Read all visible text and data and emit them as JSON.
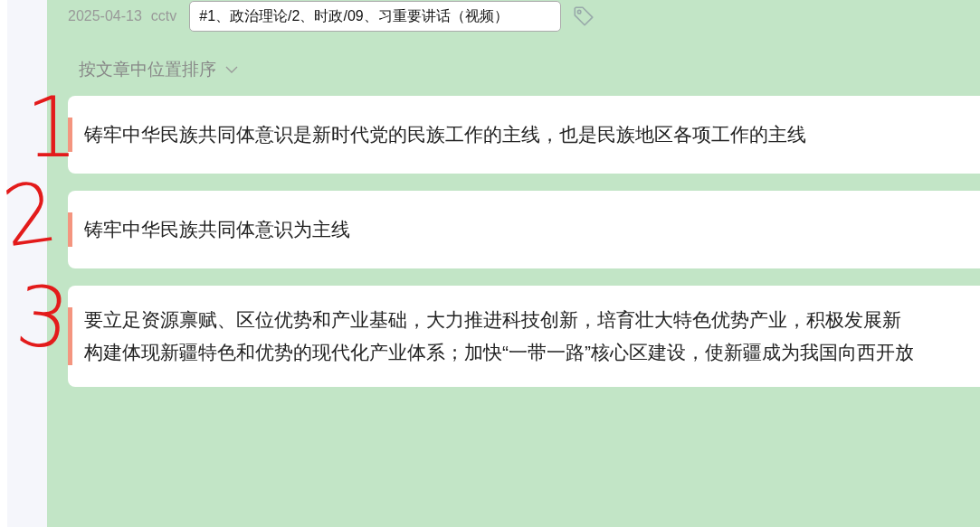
{
  "header": {
    "date": "2025-04-13",
    "source": "cctv",
    "tag_value": "#1、政治理论/2、时政/09、习重要讲话（视频）"
  },
  "sort": {
    "label": "按文章中位置排序"
  },
  "cards": [
    {
      "lines": [
        "铸牢中华民族共同体意识是新时代党的民族工作的主线，也是民族地区各项工作的主线"
      ],
      "color": "#f4957f"
    },
    {
      "lines": [
        "铸牢中华民族共同体意识为主线"
      ],
      "color": "#f4957f"
    },
    {
      "lines": [
        "要立足资源禀赋、区位优势和产业基础，大力推进科技创新，培育壮大特色优势产业，积极发展新",
        "构建体现新疆特色和优势的现代化产业体系；加快“一带一路”核心区建设，使新疆成为我国向西开放"
      ],
      "color": "#f4957f"
    }
  ],
  "annotations": [
    "1",
    "2",
    "3"
  ]
}
